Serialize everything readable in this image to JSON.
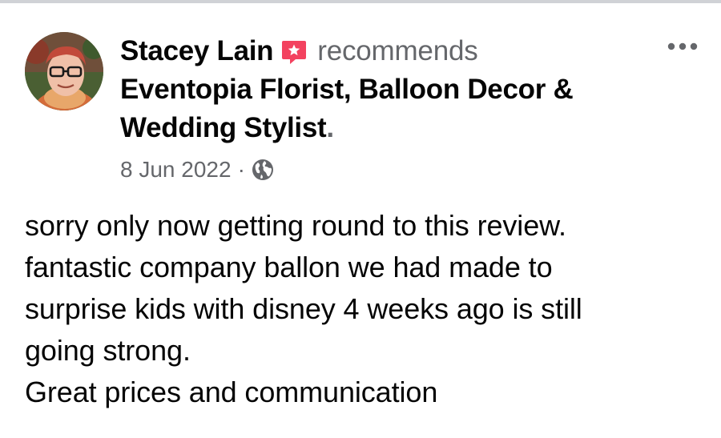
{
  "post": {
    "author": "Stacey Lain",
    "action": "recommends",
    "page_name_line1": "Eventopia Florist, Balloon Decor &",
    "page_name_line2": "Wedding Stylist",
    "page_name_suffix": ".",
    "date": "8 Jun 2022",
    "separator": "·",
    "privacy_icon": "globe-icon",
    "recommend_icon": "recommend-badge-icon",
    "more_icon": "more-options-icon",
    "body_lines": [
      "sorry only now getting round to this review.",
      "fantastic company ballon we had made to",
      "surprise kids with disney 4 weeks ago is still",
      "going strong.",
      "Great prices and communication"
    ]
  },
  "colors": {
    "primary_text": "#050505",
    "secondary_text": "#65676b",
    "recommend_badge": "#f3425f",
    "top_border": "#d0d2d6"
  }
}
